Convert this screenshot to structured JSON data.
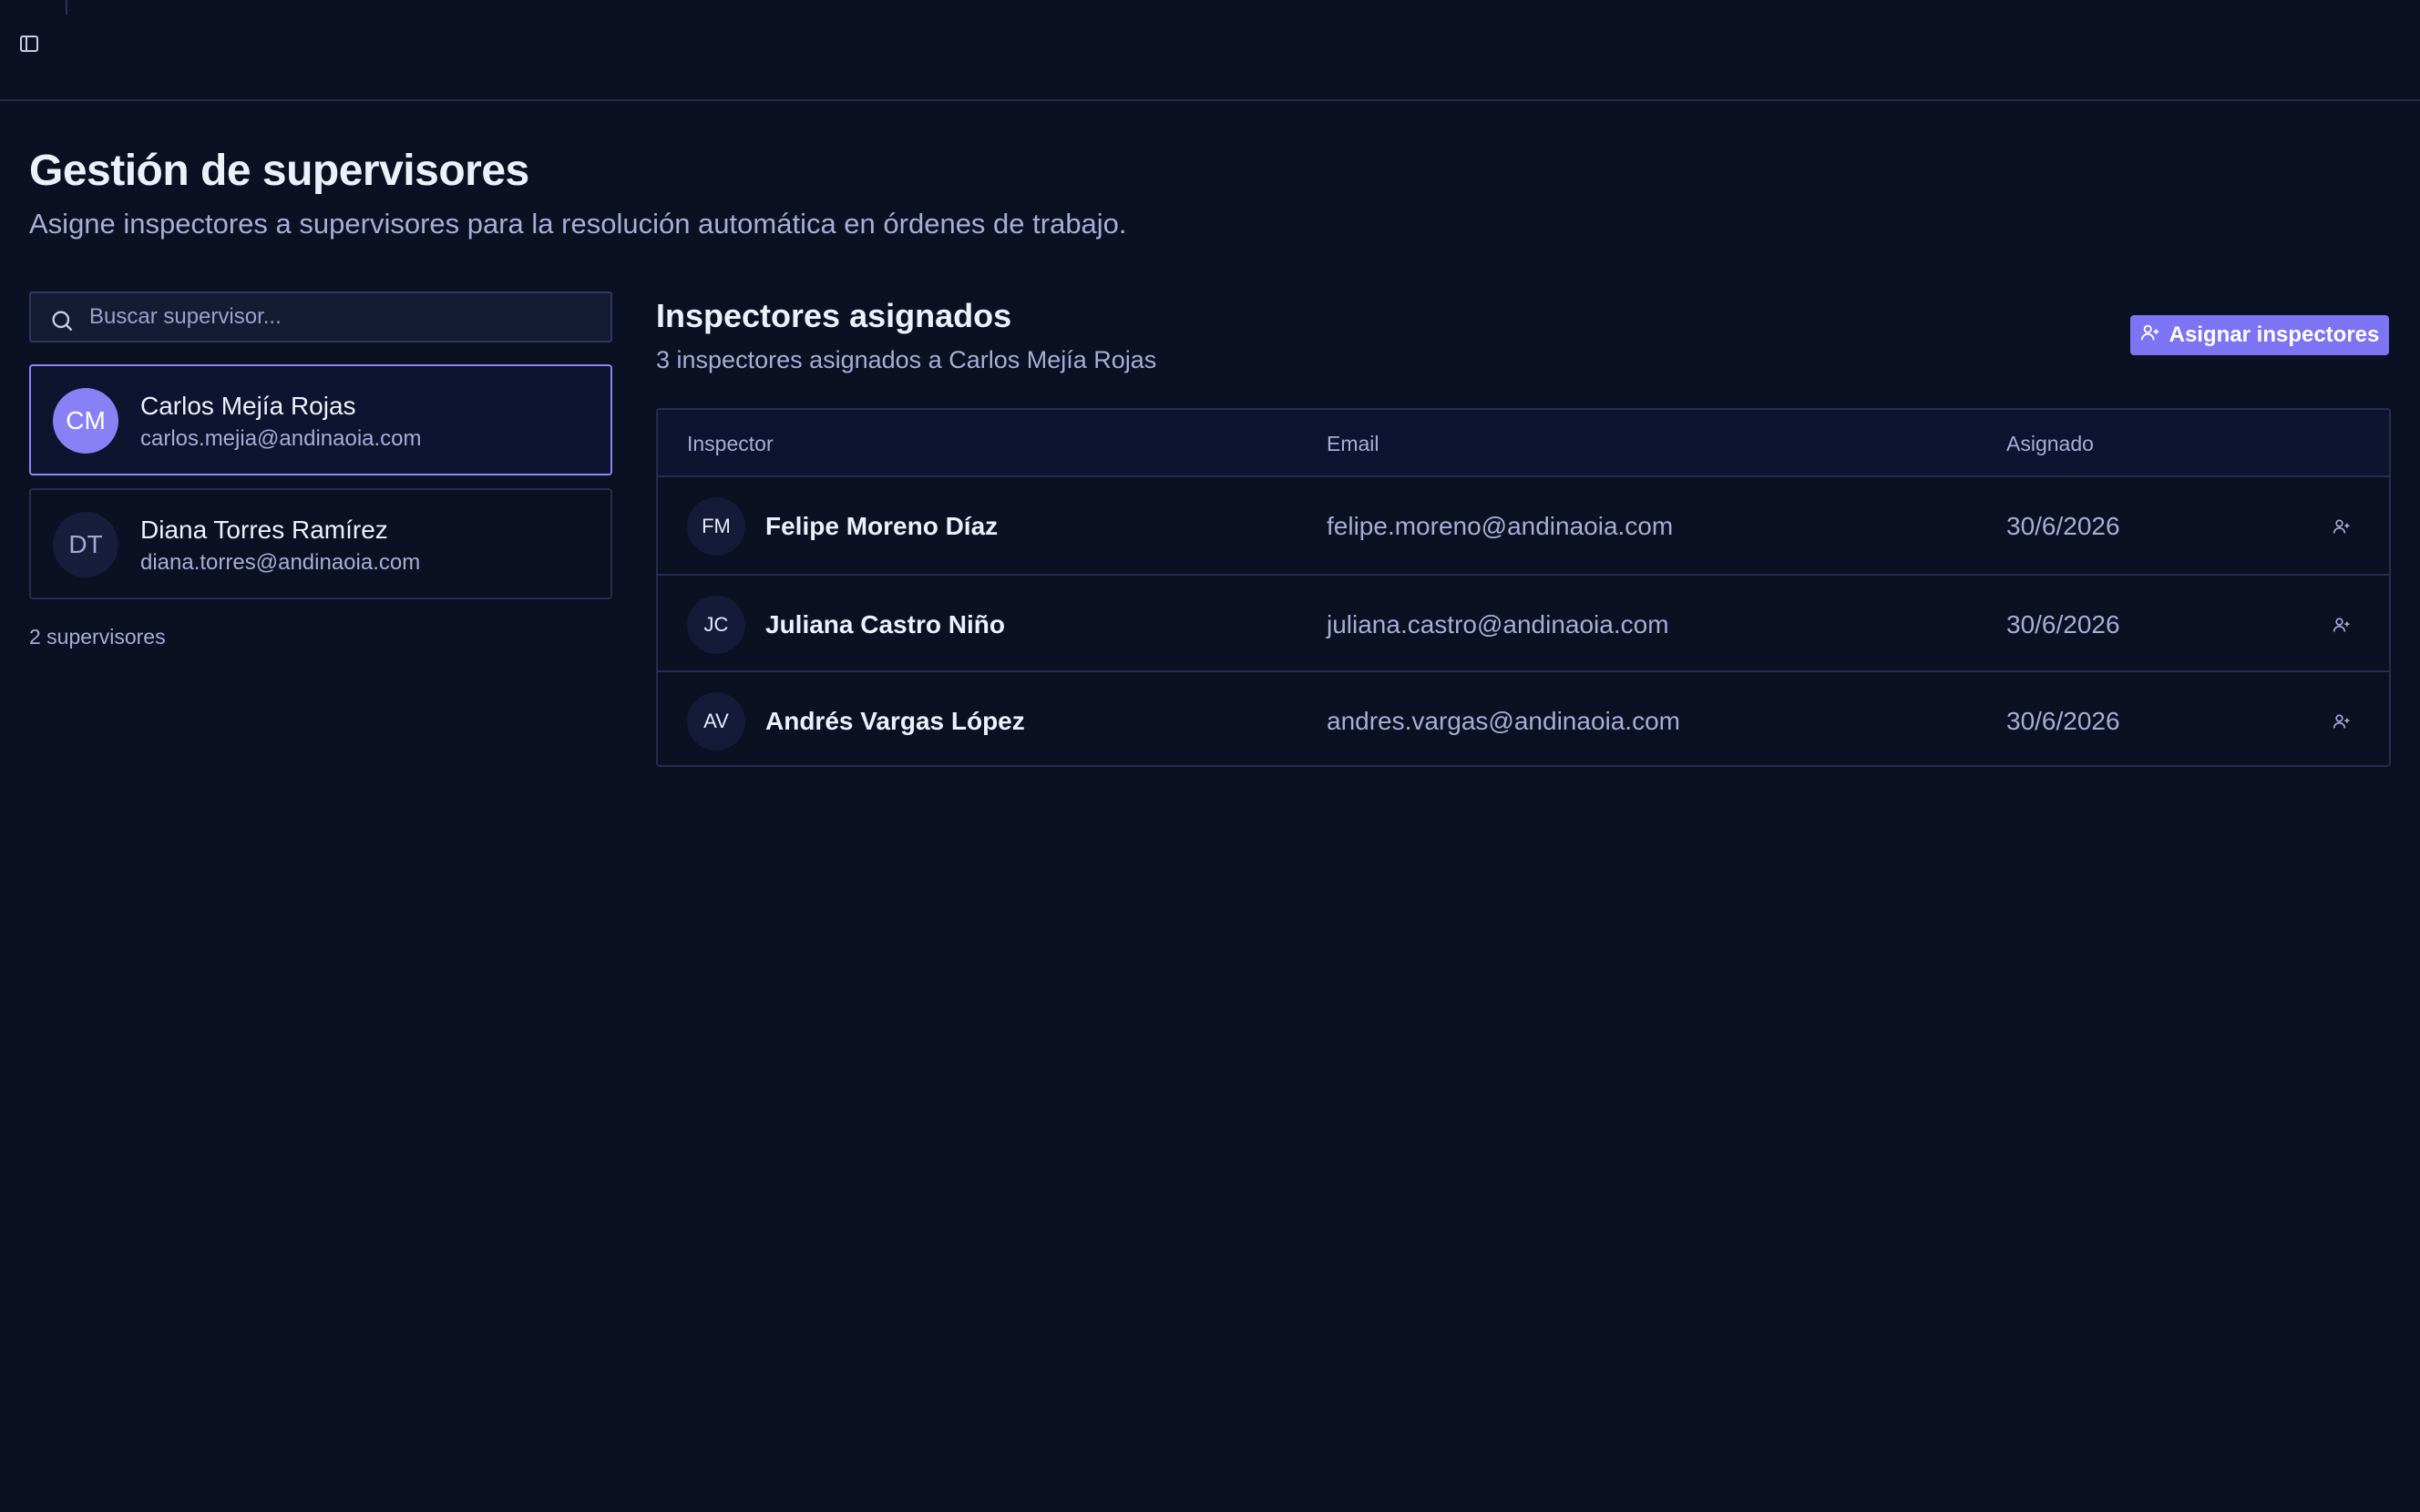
{
  "header": {
    "title": "Gestión de supervisores",
    "subtitle": "Asigne inspectores a supervisores para la resolución automática en órdenes de trabajo."
  },
  "search": {
    "placeholder": "Buscar supervisor...",
    "value": ""
  },
  "supervisors": [
    {
      "initials": "CM",
      "name": "Carlos Mejía Rojas",
      "email": "carlos.mejia@andinaoia.com",
      "selected": true
    },
    {
      "initials": "DT",
      "name": "Diana Torres Ramírez",
      "email": "diana.torres@andinaoia.com",
      "selected": false
    }
  ],
  "supervisor_count": "2 supervisores",
  "assigned": {
    "title": "Inspectores asignados",
    "subtitle": "3 inspectores asignados a Carlos Mejía Rojas",
    "button_label": "Asignar inspectores",
    "columns": [
      "Inspector",
      "Email",
      "Asignado"
    ],
    "rows": [
      {
        "initials": "FM",
        "name": "Felipe Moreno Díaz",
        "email": "felipe.moreno@andinaoia.com",
        "date": "30/6/2026"
      },
      {
        "initials": "JC",
        "name": "Juliana Castro Niño",
        "email": "juliana.castro@andinaoia.com",
        "date": "30/6/2026"
      },
      {
        "initials": "AV",
        "name": "Andrés Vargas López",
        "email": "andres.vargas@andinaoia.com",
        "date": "30/6/2026"
      }
    ]
  },
  "icons": {
    "sidebar_toggle": "sidebar-toggle-icon",
    "search": "search-icon",
    "assign": "user-plus-icon",
    "row_action": "user-plus-icon"
  },
  "colors": {
    "background": "#0b1022",
    "accent": "#7c74f2",
    "selected_border": "#8b85ff",
    "muted_text": "#a7aed6"
  }
}
